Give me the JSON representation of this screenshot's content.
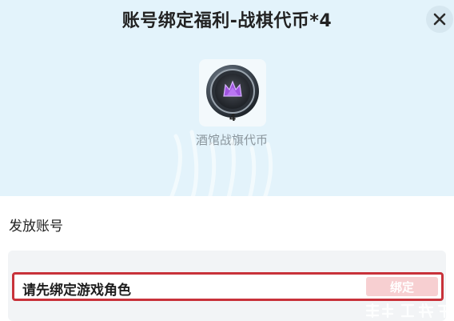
{
  "dialog": {
    "title": "账号绑定福利-战棋代币*4"
  },
  "reward": {
    "quantity": "4",
    "name": "酒馆战旗代币",
    "icon": "tavern-token-coin-icon"
  },
  "account": {
    "section_label": "发放账号",
    "prompt": "请先绑定游戏角色",
    "bind_label": "绑定"
  },
  "colors": {
    "top_panel_bg": "#e3f3fb",
    "highlight_border": "#c8323a",
    "bind_button_bg": "#f7cfd1"
  }
}
